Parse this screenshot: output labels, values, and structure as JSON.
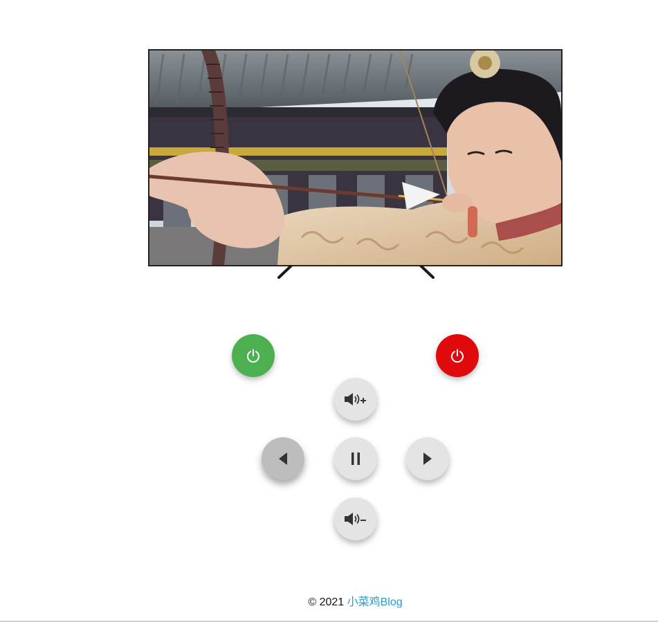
{
  "tv": {
    "image": "tv-screen-image"
  },
  "remote": {
    "power_on_icon": "power-icon",
    "power_off_icon": "power-icon",
    "volume_up_icon": "volume-up-icon",
    "volume_down_icon": "volume-down-icon",
    "prev_icon": "previous-icon",
    "pause_icon": "pause-icon",
    "next_icon": "next-icon"
  },
  "colors": {
    "power_on": "#4caf50",
    "power_off": "#e0090b",
    "button": "#e4e4e4",
    "link": "#1a9fd9"
  },
  "footer": {
    "copyright": "© 2021",
    "link_text": "小菜鸡Blog"
  }
}
